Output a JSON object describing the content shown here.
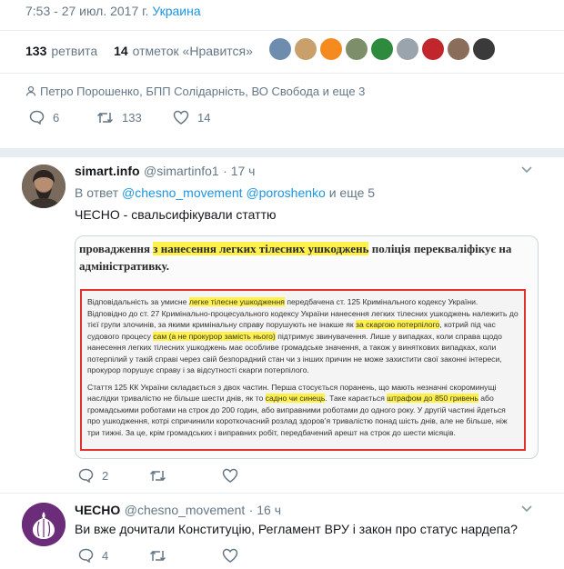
{
  "header": {
    "time_date": "7:53 - 27 июл. 2017 г.",
    "location": "Украина",
    "retweets_count": "133",
    "retweets_label": "ретвита",
    "likes_count": "14",
    "likes_label": "отметок «Нравится»",
    "liked_by": "Петро Порошенко, БПП Солідарність, ВО Свобода и еще 3",
    "replies": "6",
    "retweets": "133",
    "likes": "14"
  },
  "reply1": {
    "name": "simart.info",
    "handle": "@simartinfo1",
    "time": "· 17 ч",
    "in_reply_prefix": "В ответ",
    "mention1": "@chesno_movement",
    "mention2": "@poroshenko",
    "in_reply_suffix": "и еще 5",
    "text": "ЧЕСНО - свальсифікували статтю",
    "replies": "2",
    "retweets": "",
    "likes": "",
    "embed": {
      "top_a": "провадження ",
      "top_hl": "з нанесення легких тілесних ушкоджень",
      "top_b": " поліція перекваліфікує на адміністративку.",
      "p1_a": "Відповідальність за умисне ",
      "p1_hl1": "легке тілесне ушкодження",
      "p1_b": " передбачена ст. 125 Кримінального кодексу України. Відповідно до ст. 27 Кримінально-процесуального кодексу України нанесення легких тілесних ушкоджень належить до тієї групи злочинів, за якими кримінальну справу порушують не інакше як ",
      "p1_hl2": "за скаргою потерпілого",
      "p1_c": ", котрий під час судового процесу ",
      "p1_hl3": "сам (а не прокурор замість нього)",
      "p1_d": " підтримує звинувачення. Лише у випадках, коли справа щодо нанесення легких тілесних ушкоджень має особливе громадське значення, а також у виняткових випадках, коли потерпілий у такій справі через свій безпорадний стан чи з інших причин не може захистити свої законні інтереси, прокурор порушує справу і за відсутності скарги потерпілого.",
      "p2_a": "Стаття 125 КК України складається з двох частин. Перша стосується поранень, що мають незначні скороминущі наслідки тривалістю не більше шести днів, як то ",
      "p2_hl1": "садно чи синець",
      "p2_b": ". Таке карається ",
      "p2_hl2": "штрафом до 850 гривень",
      "p2_c": " або громадськими роботами на строк до 200 годин, або виправними роботами до одного року. У другій частині йдеться про ушкодження, котрі спричинили короткочасний розлад здоров’я тривалістю понад шість днів, але не більше, ніж три тижні. За це, крім громадських і виправних робіт, передбачений арешт на строк до шести місяців."
    }
  },
  "reply2": {
    "name": "ЧЕСНО",
    "handle": "@chesno_movement",
    "time": "· 16 ч",
    "text": "Ви вже дочитали Конституцію, Регламент ВРУ і закон про статус нардепа?",
    "replies": "4"
  },
  "colors": {
    "accent": "#1b95e0",
    "muted": "#657786",
    "highlight": "#fff14a",
    "red_frame": "#e0332e",
    "chesno_avatar": "#6b2c7a"
  }
}
